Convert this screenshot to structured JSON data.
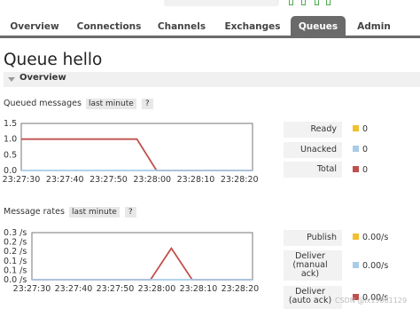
{
  "nav": {
    "tabs": [
      {
        "label": "Overview",
        "active": false
      },
      {
        "label": "Connections",
        "active": false
      },
      {
        "label": "Channels",
        "active": false
      },
      {
        "label": "Exchanges",
        "active": false
      },
      {
        "label": "Queues",
        "active": true
      },
      {
        "label": "Admin",
        "active": false
      }
    ]
  },
  "page": {
    "title_prefix": "Queue",
    "queue_name": "hello"
  },
  "overview": {
    "label": "Overview"
  },
  "queued": {
    "heading": "Queued messages",
    "range_chip": "last minute",
    "help": "?",
    "legend": [
      {
        "label": "Ready",
        "value": "0",
        "color": "#f0c030"
      },
      {
        "label": "Unacked",
        "value": "0",
        "color": "#a8cce8"
      },
      {
        "label": "Total",
        "value": "0",
        "color": "#c0504d"
      }
    ]
  },
  "rates": {
    "heading": "Message rates",
    "range_chip": "last minute",
    "help": "?",
    "legend": [
      {
        "label": "Publish",
        "value": "0.00/s",
        "color": "#f0c030"
      },
      {
        "label": "Deliver (manual ack)",
        "value": "0.00/s",
        "color": "#a8cce8"
      },
      {
        "label": "Deliver (auto ack)",
        "value": "0.00/s",
        "color": "#c0504d"
      }
    ]
  },
  "chart_data": [
    {
      "type": "line",
      "x": [
        "23:27:30",
        "23:27:40",
        "23:27:50",
        "23:28:00",
        "23:28:10",
        "23:28:20"
      ],
      "ylim": [
        0,
        1.5
      ],
      "yticks": [
        "1.5",
        "1.0",
        "0.5",
        "0.0"
      ],
      "series": [
        {
          "name": "Total",
          "color": "#c0504d",
          "points": [
            [
              0,
              1.0
            ],
            [
              2.65,
              1.0
            ],
            [
              3.1,
              0.0
            ],
            [
              5.3,
              0.0
            ]
          ]
        },
        {
          "name": "Unacked",
          "color": "#a8cce8",
          "points": [
            [
              0,
              0
            ],
            [
              5.3,
              0
            ]
          ]
        }
      ]
    },
    {
      "type": "line",
      "x": [
        "23:27:30",
        "23:27:40",
        "23:27:50",
        "23:28:00",
        "23:28:10",
        "23:28:20"
      ],
      "ylim": [
        0,
        0.3
      ],
      "yticks": [
        "0.3 /s",
        "0.2 /s",
        "0.2 /s",
        "0.1 /s",
        "0.1 /s",
        "0.0 /s"
      ],
      "series": [
        {
          "name": "Deliver (auto ack)",
          "color": "#c0504d",
          "points": [
            [
              0,
              0
            ],
            [
              2.85,
              0
            ],
            [
              3.35,
              0.2
            ],
            [
              3.85,
              0
            ],
            [
              5.3,
              0
            ]
          ]
        },
        {
          "name": "Deliver (manual ack)",
          "color": "#a8cce8",
          "points": [
            [
              0,
              0
            ],
            [
              5.3,
              0
            ]
          ]
        }
      ]
    }
  ],
  "watermark": "CSDN @lx19081129"
}
